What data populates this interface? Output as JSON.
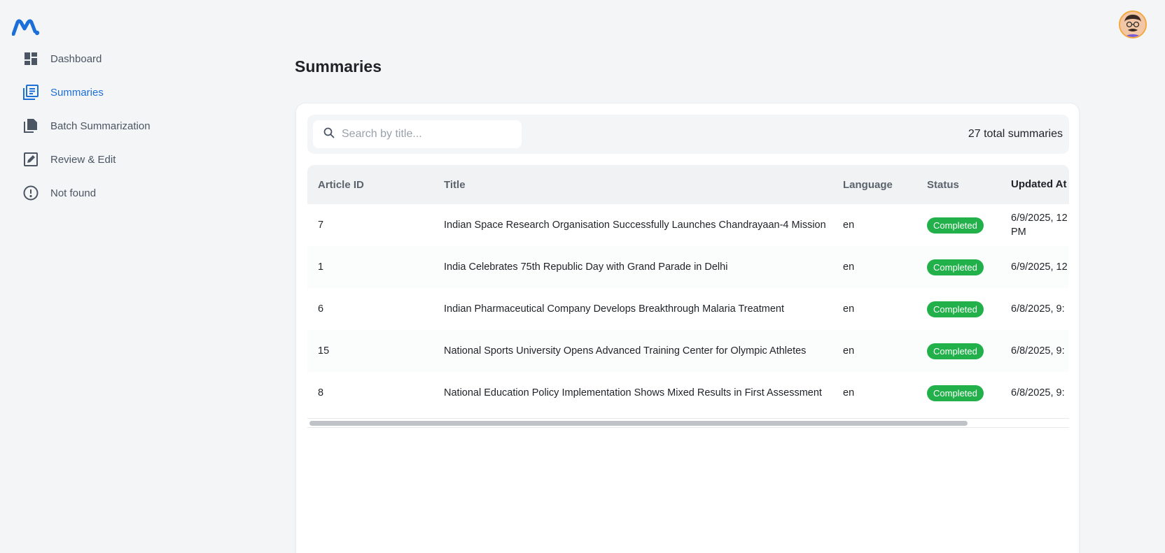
{
  "nav": {
    "items": [
      {
        "label": "Dashboard",
        "icon": "dashboard-icon",
        "active": false
      },
      {
        "label": "Summaries",
        "icon": "summaries-icon",
        "active": true
      },
      {
        "label": "Batch Summarization",
        "icon": "file-copy-icon",
        "active": false
      },
      {
        "label": "Review & Edit",
        "icon": "edit-icon",
        "active": false
      },
      {
        "label": "Not found",
        "icon": "alert-circle-icon",
        "active": false
      }
    ]
  },
  "page": {
    "title": "Summaries"
  },
  "search": {
    "placeholder": "Search by title..."
  },
  "total_label": "27 total summaries",
  "table": {
    "columns": [
      "Article ID",
      "Title",
      "Language",
      "Status",
      "Updated At"
    ],
    "rows": [
      {
        "id": "7",
        "title": "Indian Space Research Organisation Successfully Launches Chandrayaan-4 Mission",
        "language": "en",
        "status": "Completed",
        "updated": "6/9/2025, 12",
        "updated2": "PM"
      },
      {
        "id": "1",
        "title": "India Celebrates 75th Republic Day with Grand Parade in Delhi",
        "language": "en",
        "status": "Completed",
        "updated": "6/9/2025, 12",
        "updated2": ""
      },
      {
        "id": "6",
        "title": "Indian Pharmaceutical Company Develops Breakthrough Malaria Treatment",
        "language": "en",
        "status": "Completed",
        "updated": "6/8/2025, 9:",
        "updated2": ""
      },
      {
        "id": "15",
        "title": "National Sports University Opens Advanced Training Center for Olympic Athletes",
        "language": "en",
        "status": "Completed",
        "updated": "6/8/2025, 9:",
        "updated2": ""
      },
      {
        "id": "8",
        "title": "National Education Policy Implementation Shows Mixed Results in First Assessment",
        "language": "en",
        "status": "Completed",
        "updated": "6/8/2025, 9:",
        "updated2": ""
      }
    ]
  },
  "colors": {
    "accent": "#1d6fd8",
    "status_completed": "#22b04b"
  }
}
